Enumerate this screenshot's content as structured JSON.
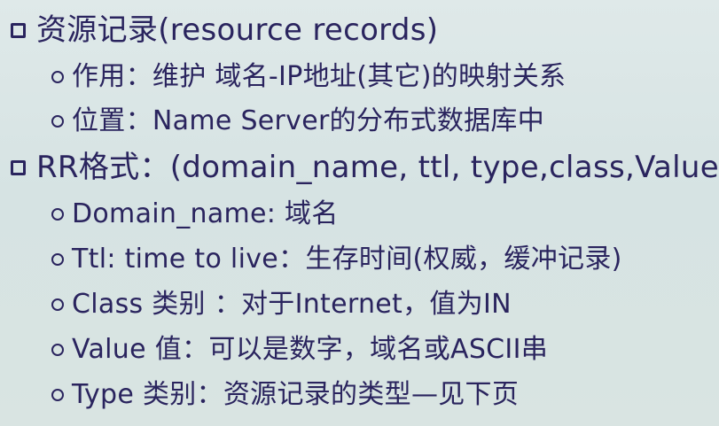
{
  "items": [
    {
      "level": 1,
      "text": "资源记录(resource records)"
    },
    {
      "level": 2,
      "text": "作用：维护 域名-IP地址(其它)的映射关系"
    },
    {
      "level": 2,
      "text": "位置：Name Server的分布式数据库中"
    },
    {
      "level": 1,
      "text": "RR格式：(domain_name, ttl, type,class,Value)"
    },
    {
      "level": 2,
      "text": "Domain_name: 域名"
    },
    {
      "level": 2,
      "text": "Ttl: time to live：生存时间(权威，缓冲记录)"
    },
    {
      "level": 2,
      "text": "Class 类别 ：对于Internet，值为IN"
    },
    {
      "level": 2,
      "text": "Value 值：可以是数字，域名或ASCII串"
    },
    {
      "level": 2,
      "text": "Type 类别：资源记录的类型—见下页"
    }
  ]
}
